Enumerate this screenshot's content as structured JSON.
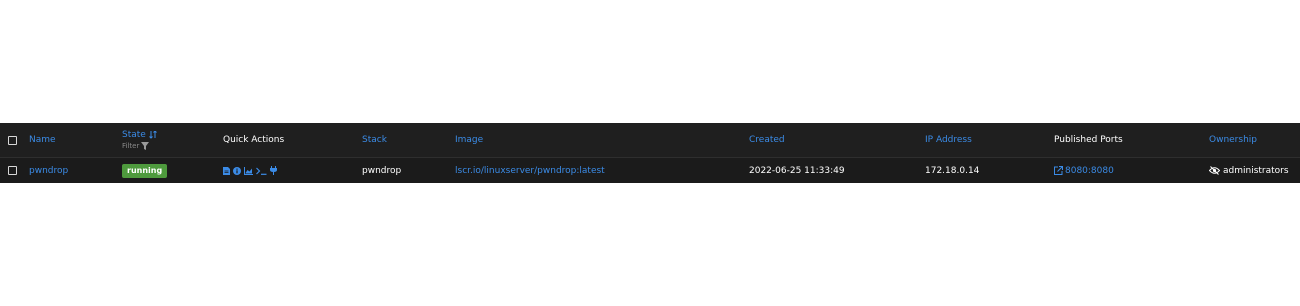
{
  "table": {
    "headers": {
      "name": "Name",
      "state": "State",
      "state_filter": "Filter",
      "quick_actions": "Quick Actions",
      "stack": "Stack",
      "image": "Image",
      "created": "Created",
      "ip_address": "IP Address",
      "published_ports": "Published Ports",
      "ownership": "Ownership"
    },
    "rows": [
      {
        "name": "pwndrop",
        "state": "running",
        "quick_actions": [
          "logs-icon",
          "inspect-icon",
          "stats-icon",
          "console-icon",
          "attach-icon"
        ],
        "stack": "pwndrop",
        "image": "lscr.io/linuxserver/pwndrop:latest",
        "created": "2022-06-25 11:33:49",
        "ip_address": "172.18.0.14",
        "published_ports": "8080:8080",
        "ownership": "administrators"
      }
    ]
  },
  "colors": {
    "table_bg": "#1f1f1f",
    "link": "#3b8be6",
    "badge_running": "#4e9a3d"
  }
}
